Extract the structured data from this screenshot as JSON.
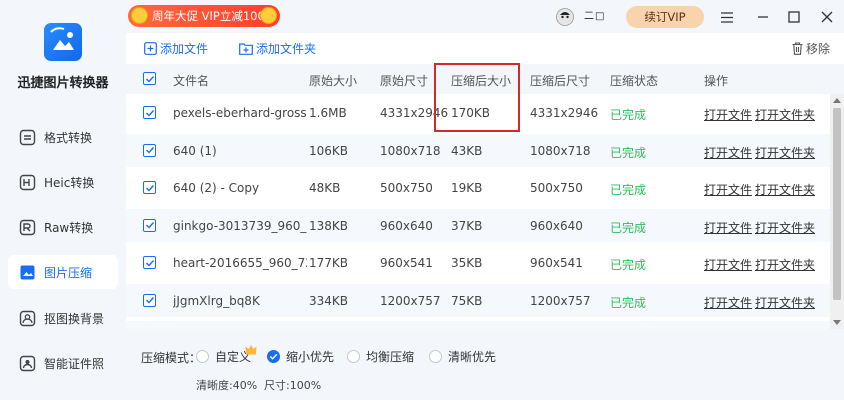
{
  "app": {
    "name": "迅捷图片转换器"
  },
  "colors": {
    "accent": "#1a6cf3",
    "promo": "#ff4a34",
    "done": "#2bbf5c",
    "highlight": "#d12a2a"
  },
  "sidebar": {
    "items": [
      {
        "label": "格式转换",
        "icon": "format-convert-icon"
      },
      {
        "label": "Heic转换",
        "icon": "heic-icon"
      },
      {
        "label": "Raw转换",
        "icon": "raw-icon"
      },
      {
        "label": "图片压缩",
        "icon": "image-compress-icon",
        "active": true
      },
      {
        "label": "抠图换背景",
        "icon": "cutout-icon"
      },
      {
        "label": "智能证件照",
        "icon": "id-photo-icon"
      }
    ]
  },
  "topbar": {
    "promo": "周年大促 VIP立减100元",
    "user": "二□",
    "vip_button": "续订VIP"
  },
  "toolbar": {
    "add_file": "添加文件",
    "add_folder": "添加文件夹",
    "remove": "移除"
  },
  "table": {
    "headers": [
      "文件名",
      "原始大小",
      "原始尺寸",
      "压缩后大小",
      "压缩后尺寸",
      "压缩状态",
      "操作"
    ],
    "rows": [
      {
        "name": "pexels-eberhard-grossgas...",
        "orig_size": "1.6MB",
        "orig_dim": "4331x2946",
        "new_size": "170KB",
        "new_dim": "4331x2946",
        "status": "已完成"
      },
      {
        "name": "640 (1)",
        "orig_size": "106KB",
        "orig_dim": "1080x718",
        "new_size": "43KB",
        "new_dim": "1080x718",
        "status": "已完成"
      },
      {
        "name": "640 (2) - Copy",
        "orig_size": "48KB",
        "orig_dim": "500x750",
        "new_size": "19KB",
        "new_dim": "500x750",
        "status": "已完成"
      },
      {
        "name": "ginkgo-3013739_960_720",
        "orig_size": "138KB",
        "orig_dim": "960x640",
        "new_size": "37KB",
        "new_dim": "960x640",
        "status": "已完成"
      },
      {
        "name": "heart-2016655_960_720",
        "orig_size": "177KB",
        "orig_dim": "960x541",
        "new_size": "35KB",
        "new_dim": "960x541",
        "status": "已完成"
      },
      {
        "name": "jJgmXlrg_bq8K",
        "orig_size": "334KB",
        "orig_dim": "1200x757",
        "new_size": "75KB",
        "new_dim": "1200x757",
        "status": "已完成"
      }
    ],
    "actions": {
      "open_file": "打开文件",
      "open_folder": "打开文件夹"
    }
  },
  "footer": {
    "mode_label": "压缩模式：",
    "options": [
      "自定义",
      "缩小优先",
      "均衡压缩",
      "清晰优先"
    ],
    "selected": "缩小优先",
    "clarity": "清晰度:40%",
    "size": "尺寸:100%"
  }
}
